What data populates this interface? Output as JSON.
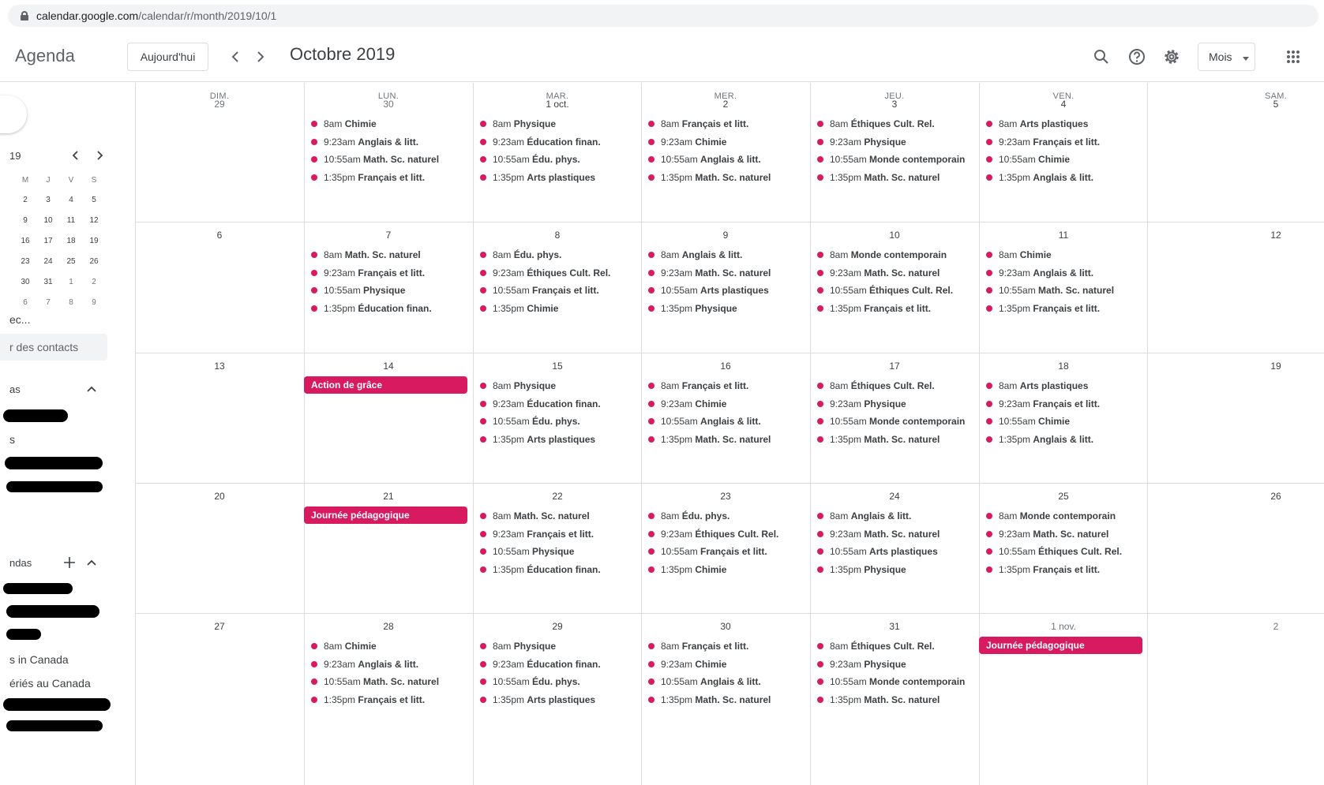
{
  "browser": {
    "url_domain": "calendar.google.com",
    "url_path": "/calendar/r/month/2019/10/1"
  },
  "header": {
    "app_title": "Agenda",
    "today_label": "Aujourd'hui",
    "month_title": "Octobre 2019",
    "view_label": "Mois",
    "icons": [
      "search-icon",
      "help-icon",
      "gear-icon",
      "apps-grid-icon"
    ]
  },
  "sidebar": {
    "mini_calendar": {
      "year_fragment": "19",
      "weekday_headers": [
        "M",
        "J",
        "V",
        "S"
      ],
      "weeks": [
        [
          "2",
          "3",
          "4",
          "5"
        ],
        [
          "9",
          "10",
          "11",
          "12"
        ],
        [
          "16",
          "17",
          "18",
          "19"
        ],
        [
          "23",
          "24",
          "25",
          "26"
        ],
        [
          "30",
          "31",
          "1",
          "2"
        ],
        [
          "6",
          "7",
          "8",
          "9"
        ]
      ]
    },
    "meet_title": "ec...",
    "contacts_placeholder": "r des contacts",
    "my_calendars_title": "as",
    "my_calendars_item": "s",
    "other_calendars_title": "ndas",
    "other_items": [
      "s in Canada",
      "ériés au Canada"
    ]
  },
  "calendar": {
    "weekdays": [
      "DIM.",
      "LUN.",
      "MAR.",
      "MER.",
      "JEU.",
      "VEN.",
      "SAM."
    ],
    "accent_color": "#d81b60",
    "weeks": [
      {
        "days": [
          {
            "num": "29",
            "other": true,
            "events": []
          },
          {
            "num": "30",
            "other": true,
            "events": [
              {
                "time": "8am",
                "title": "Chimie"
              },
              {
                "time": "9:23am",
                "title": "Anglais & litt."
              },
              {
                "time": "10:55am",
                "title": "Math. Sc. naturel"
              },
              {
                "time": "1:35pm",
                "title": "Français et litt."
              }
            ]
          },
          {
            "num": "1 oct.",
            "events": [
              {
                "time": "8am",
                "title": "Physique"
              },
              {
                "time": "9:23am",
                "title": "Éducation finan."
              },
              {
                "time": "10:55am",
                "title": "Édu. phys."
              },
              {
                "time": "1:35pm",
                "title": "Arts plastiques"
              }
            ]
          },
          {
            "num": "2",
            "events": [
              {
                "time": "8am",
                "title": "Français et litt."
              },
              {
                "time": "9:23am",
                "title": "Chimie"
              },
              {
                "time": "10:55am",
                "title": "Anglais & litt."
              },
              {
                "time": "1:35pm",
                "title": "Math. Sc. naturel"
              }
            ]
          },
          {
            "num": "3",
            "events": [
              {
                "time": "8am",
                "title": "Éthiques Cult. Rel."
              },
              {
                "time": "9:23am",
                "title": "Physique"
              },
              {
                "time": "10:55am",
                "title": "Monde contemporain"
              },
              {
                "time": "1:35pm",
                "title": "Math. Sc. naturel"
              }
            ]
          },
          {
            "num": "4",
            "events": [
              {
                "time": "8am",
                "title": "Arts plastiques"
              },
              {
                "time": "9:23am",
                "title": "Français et litt."
              },
              {
                "time": "10:55am",
                "title": "Chimie"
              },
              {
                "time": "1:35pm",
                "title": "Anglais & litt."
              }
            ]
          },
          {
            "num": "5",
            "events": []
          }
        ]
      },
      {
        "days": [
          {
            "num": "6",
            "events": []
          },
          {
            "num": "7",
            "events": [
              {
                "time": "8am",
                "title": "Math. Sc. naturel"
              },
              {
                "time": "9:23am",
                "title": "Français et litt."
              },
              {
                "time": "10:55am",
                "title": "Physique"
              },
              {
                "time": "1:35pm",
                "title": "Éducation finan."
              }
            ]
          },
          {
            "num": "8",
            "events": [
              {
                "time": "8am",
                "title": "Édu. phys."
              },
              {
                "time": "9:23am",
                "title": "Éthiques Cult. Rel."
              },
              {
                "time": "10:55am",
                "title": "Français et litt."
              },
              {
                "time": "1:35pm",
                "title": "Chimie"
              }
            ]
          },
          {
            "num": "9",
            "events": [
              {
                "time": "8am",
                "title": "Anglais & litt."
              },
              {
                "time": "9:23am",
                "title": "Math. Sc. naturel"
              },
              {
                "time": "10:55am",
                "title": "Arts plastiques"
              },
              {
                "time": "1:35pm",
                "title": "Physique"
              }
            ]
          },
          {
            "num": "10",
            "events": [
              {
                "time": "8am",
                "title": "Monde contemporain"
              },
              {
                "time": "9:23am",
                "title": "Math. Sc. naturel"
              },
              {
                "time": "10:55am",
                "title": "Éthiques Cult. Rel."
              },
              {
                "time": "1:35pm",
                "title": "Français et litt."
              }
            ]
          },
          {
            "num": "11",
            "events": [
              {
                "time": "8am",
                "title": "Chimie"
              },
              {
                "time": "9:23am",
                "title": "Anglais & litt."
              },
              {
                "time": "10:55am",
                "title": "Math. Sc. naturel"
              },
              {
                "time": "1:35pm",
                "title": "Français et litt."
              }
            ]
          },
          {
            "num": "12",
            "events": []
          }
        ]
      },
      {
        "days": [
          {
            "num": "13",
            "events": []
          },
          {
            "num": "14",
            "allday": "Action de grâce",
            "events": []
          },
          {
            "num": "15",
            "events": [
              {
                "time": "8am",
                "title": "Physique"
              },
              {
                "time": "9:23am",
                "title": "Éducation finan."
              },
              {
                "time": "10:55am",
                "title": "Édu. phys."
              },
              {
                "time": "1:35pm",
                "title": "Arts plastiques"
              }
            ]
          },
          {
            "num": "16",
            "events": [
              {
                "time": "8am",
                "title": "Français et litt."
              },
              {
                "time": "9:23am",
                "title": "Chimie"
              },
              {
                "time": "10:55am",
                "title": "Anglais & litt."
              },
              {
                "time": "1:35pm",
                "title": "Math. Sc. naturel"
              }
            ]
          },
          {
            "num": "17",
            "events": [
              {
                "time": "8am",
                "title": "Éthiques Cult. Rel."
              },
              {
                "time": "9:23am",
                "title": "Physique"
              },
              {
                "time": "10:55am",
                "title": "Monde contemporain"
              },
              {
                "time": "1:35pm",
                "title": "Math. Sc. naturel"
              }
            ]
          },
          {
            "num": "18",
            "events": [
              {
                "time": "8am",
                "title": "Arts plastiques"
              },
              {
                "time": "9:23am",
                "title": "Français et litt."
              },
              {
                "time": "10:55am",
                "title": "Chimie"
              },
              {
                "time": "1:35pm",
                "title": "Anglais & litt."
              }
            ]
          },
          {
            "num": "19",
            "events": []
          }
        ]
      },
      {
        "days": [
          {
            "num": "20",
            "events": []
          },
          {
            "num": "21",
            "allday": "Journée pédagogique",
            "events": []
          },
          {
            "num": "22",
            "events": [
              {
                "time": "8am",
                "title": "Math. Sc. naturel"
              },
              {
                "time": "9:23am",
                "title": "Français et litt."
              },
              {
                "time": "10:55am",
                "title": "Physique"
              },
              {
                "time": "1:35pm",
                "title": "Éducation finan."
              }
            ]
          },
          {
            "num": "23",
            "events": [
              {
                "time": "8am",
                "title": "Édu. phys."
              },
              {
                "time": "9:23am",
                "title": "Éthiques Cult. Rel."
              },
              {
                "time": "10:55am",
                "title": "Français et litt."
              },
              {
                "time": "1:35pm",
                "title": "Chimie"
              }
            ]
          },
          {
            "num": "24",
            "events": [
              {
                "time": "8am",
                "title": "Anglais & litt."
              },
              {
                "time": "9:23am",
                "title": "Math. Sc. naturel"
              },
              {
                "time": "10:55am",
                "title": "Arts plastiques"
              },
              {
                "time": "1:35pm",
                "title": "Physique"
              }
            ]
          },
          {
            "num": "25",
            "events": [
              {
                "time": "8am",
                "title": "Monde contemporain"
              },
              {
                "time": "9:23am",
                "title": "Math. Sc. naturel"
              },
              {
                "time": "10:55am",
                "title": "Éthiques Cult. Rel."
              },
              {
                "time": "1:35pm",
                "title": "Français et litt."
              }
            ]
          },
          {
            "num": "26",
            "events": []
          }
        ]
      },
      {
        "days": [
          {
            "num": "27",
            "events": []
          },
          {
            "num": "28",
            "events": [
              {
                "time": "8am",
                "title": "Chimie"
              },
              {
                "time": "9:23am",
                "title": "Anglais & litt."
              },
              {
                "time": "10:55am",
                "title": "Math. Sc. naturel"
              },
              {
                "time": "1:35pm",
                "title": "Français et litt."
              }
            ]
          },
          {
            "num": "29",
            "events": [
              {
                "time": "8am",
                "title": "Physique"
              },
              {
                "time": "9:23am",
                "title": "Éducation finan."
              },
              {
                "time": "10:55am",
                "title": "Édu. phys."
              },
              {
                "time": "1:35pm",
                "title": "Arts plastiques"
              }
            ]
          },
          {
            "num": "30",
            "events": [
              {
                "time": "8am",
                "title": "Français et litt."
              },
              {
                "time": "9:23am",
                "title": "Chimie"
              },
              {
                "time": "10:55am",
                "title": "Anglais & litt."
              },
              {
                "time": "1:35pm",
                "title": "Math. Sc. naturel"
              }
            ]
          },
          {
            "num": "31",
            "events": [
              {
                "time": "8am",
                "title": "Éthiques Cult. Rel."
              },
              {
                "time": "9:23am",
                "title": "Physique"
              },
              {
                "time": "10:55am",
                "title": "Monde contemporain"
              },
              {
                "time": "1:35pm",
                "title": "Math. Sc. naturel"
              }
            ]
          },
          {
            "num": "1 nov.",
            "other": true,
            "allday": "Journée pédagogique",
            "events": []
          },
          {
            "num": "2",
            "other": true,
            "events": []
          }
        ]
      }
    ]
  }
}
